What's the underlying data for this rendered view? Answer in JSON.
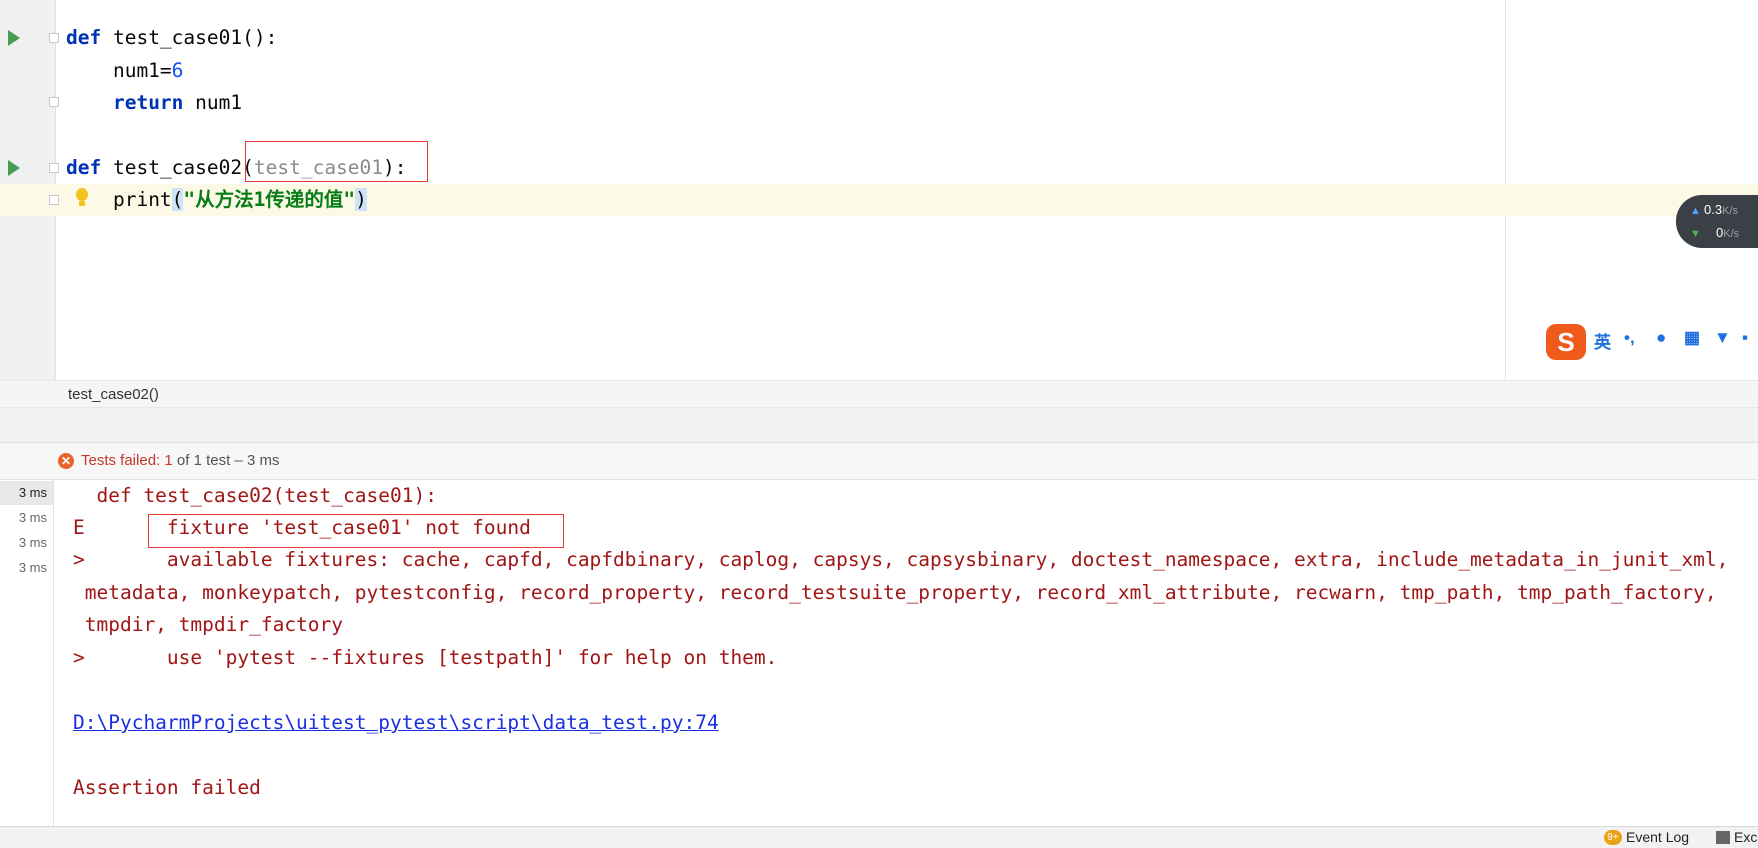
{
  "editor": {
    "lines": {
      "l1": {
        "kw": "def",
        "name": " test_case01",
        "rest": "():"
      },
      "l2": {
        "lead": "    num1=",
        "num": "6"
      },
      "l3": {
        "kw": "return",
        "rest": " num1"
      },
      "l5": {
        "kw": "def",
        "name": " test_case02",
        "open": "(",
        "param": "test_case01",
        "close": "):"
      },
      "l6": {
        "fn": "print",
        "open": "(",
        "str": "\"从方法1传递的值\"",
        "close": ")"
      }
    },
    "breadcrumb": "test_case02()"
  },
  "widgets": {
    "upload_speed": "0.3",
    "download_speed": "0",
    "speed_unit": "K/s",
    "ime_logo": "S",
    "ime_lang": "英",
    "ime_punct": "•,"
  },
  "run": {
    "status_label": "Tests failed:",
    "failed_count": "1",
    "summary": " of 1 test – 3 ms",
    "durations": [
      "3 ms",
      "3 ms",
      "3 ms",
      "3 ms"
    ],
    "console": {
      "c1": "  def test_case02(test_case01):",
      "c2": "E       fixture 'test_case01' not found",
      "c3": ">       available fixtures: cache, capfd, capfdbinary, caplog, capsys, capsysbinary, doctest_namespace, extra, include_metadata_in_junit_xml,",
      "c4": " metadata, monkeypatch, pytestconfig, record_property, record_testsuite_property, record_xml_attribute, recwarn, tmp_path, tmp_path_factory,",
      "c5": " tmpdir, tmpdir_factory",
      "c6": ">       use 'pytest --fixtures [testpath]' for help on them.",
      "link": "D:\\PycharmProjects\\uitest_pytest\\script\\data_test.py:74",
      "assert": "Assertion failed"
    }
  },
  "statusbar": {
    "event_badge": "9+",
    "event_log": "Event Log",
    "excel": "Exc"
  }
}
